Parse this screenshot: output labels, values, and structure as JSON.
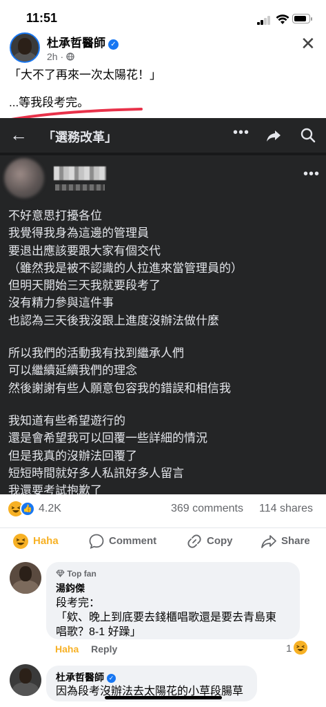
{
  "status": {
    "time": "11:51"
  },
  "post": {
    "author": "杜承哲醫師",
    "time": "2h",
    "line1": "「大不了再來一次太陽花！」",
    "line2": "...等我段考完。"
  },
  "screenshot": {
    "title": "「選務改革」",
    "body": [
      "不好意思打擾各位",
      "我覺得我身為這邊的管理員",
      "要退出應該要跟大家有個交代",
      "（雖然我是被不認識的人拉進來當管理員的）",
      "但明天開始三天我就要段考了",
      "沒有精力參與這件事",
      "也認為三天後我沒跟上進度沒辦法做什麼",
      "",
      "所以我們的活動我有找到繼承人們",
      "可以繼續延續我們的理念",
      "然後謝謝有些人願意包容我的錯誤和相信我",
      "",
      "我知道有些希望遊行的",
      "還是會希望我可以回覆一些詳細的情況",
      "但是我真的沒辦法回覆了",
      "短短時間就好多人私訊好多人留言",
      "我還要考試抱歉了"
    ]
  },
  "stats": {
    "reactions": "4.2K",
    "comments": "369 comments",
    "shares": "114 shares"
  },
  "actions": {
    "haha": "Haha",
    "comment": "Comment",
    "copy": "Copy",
    "share": "Share"
  },
  "comments": [
    {
      "badge": "Top fan",
      "name": "湯鈞傑",
      "lines": [
        "段考完：",
        "「欸、晚上到底要去錢櫃唱歌還是要去青島東",
        "唱歌？8-1 好躁」"
      ],
      "reaction_label": "Haha",
      "reply_label": "Reply",
      "reaction_count": "1"
    },
    {
      "name": "杜承哲醫師",
      "lines": [
        "因為段考沒辦法去太陽花的小草段腸草"
      ]
    }
  ],
  "colors": {
    "accent": "#1877f2",
    "haha": "#f7b125",
    "dark_bg": "#242526",
    "underline": "#e8324a"
  }
}
